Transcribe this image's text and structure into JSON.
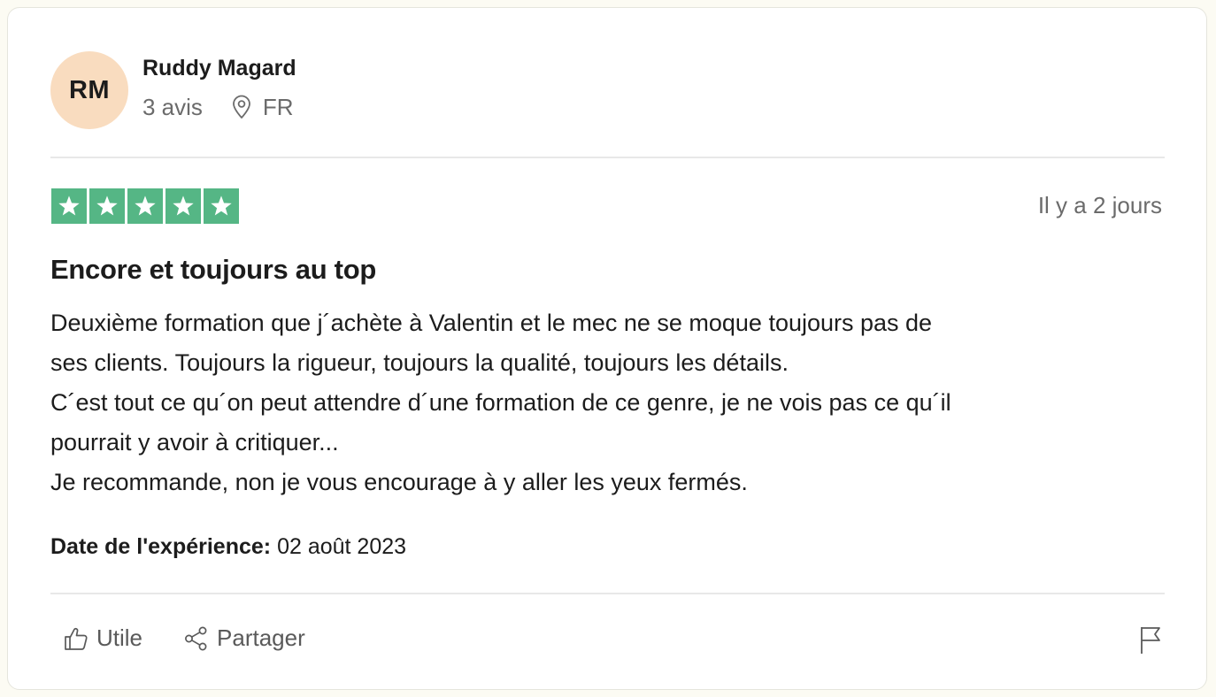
{
  "reviewer": {
    "initials": "RM",
    "name": "Ruddy Magard",
    "reviews_count": "3 avis",
    "country": "FR",
    "avatar_color": "#f9dcbf"
  },
  "review": {
    "rating": 5,
    "max_rating": 5,
    "star_color": "#55b685",
    "date_ago": "Il y a 2 jours",
    "title": "Encore et toujours au top",
    "body_lines": [
      "Deuxième formation que j´achète à Valentin et le mec ne se moque toujours pas de",
      "ses clients. Toujours la rigueur, toujours la qualité, toujours les détails.",
      "C´est tout ce qu´on peut attendre d´une formation de ce genre, je ne vois pas ce qu´il",
      "pourrait y avoir à critiquer...",
      "Je recommande, non je vous encourage à y aller les yeux fermés."
    ],
    "experience_label": "Date de l'expérience:",
    "experience_date": "02 août 2023"
  },
  "actions": {
    "useful_label": "Utile",
    "share_label": "Partager",
    "useful_icon": "thumbs-up-icon",
    "share_icon": "share-icon",
    "report_icon": "flag-icon"
  }
}
